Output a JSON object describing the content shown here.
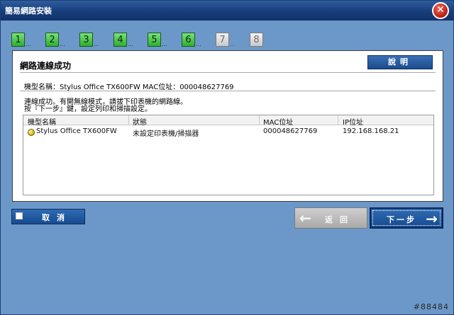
{
  "window": {
    "title": "簡易網路安裝",
    "close_glyph": "✕"
  },
  "steps": [
    {
      "label": "1",
      "dots": "...",
      "state": "active"
    },
    {
      "label": "2",
      "dots": "...",
      "state": "active"
    },
    {
      "label": "3",
      "dots": "...",
      "state": "active"
    },
    {
      "label": "4",
      "dots": "...",
      "state": "active"
    },
    {
      "label": "5",
      "dots": "...",
      "state": "active"
    },
    {
      "label": "6",
      "dots": "...",
      "state": "active"
    },
    {
      "label": "7",
      "dots": "...",
      "state": "disabled"
    },
    {
      "label": "8",
      "dots": "",
      "state": "disabled"
    }
  ],
  "panel": {
    "heading": "網路連線成功",
    "help_button": "說明",
    "device_line": "機型名稱：Stylus Office TX600FW    MAC位址：000048627769",
    "message_line1": "連線成功。有開無線模式，請拔下印表機的網路線。",
    "message_line2": "按『下一步』鍵，設定列印和掃描設定。"
  },
  "table": {
    "headers": [
      "機型名稱",
      "狀態",
      "MAC位址",
      "IP位址"
    ],
    "rows": [
      {
        "name": "Stylus Office TX600FW",
        "status": "未設定印表機/掃描器",
        "mac": "000048627769",
        "ip": "192.168.168.21"
      }
    ]
  },
  "buttons": {
    "cancel": "取消",
    "back": "返回",
    "back_arrow": "←",
    "next": "下一步",
    "next_arrow": "→"
  },
  "watermark": "#88484",
  "colors": {
    "window_bg": "#6b98c8",
    "title_bar": "#183d7a",
    "step_green": "#2fae2f",
    "button_blue": "#174a8f",
    "back_gray": "#a9a9a9"
  }
}
